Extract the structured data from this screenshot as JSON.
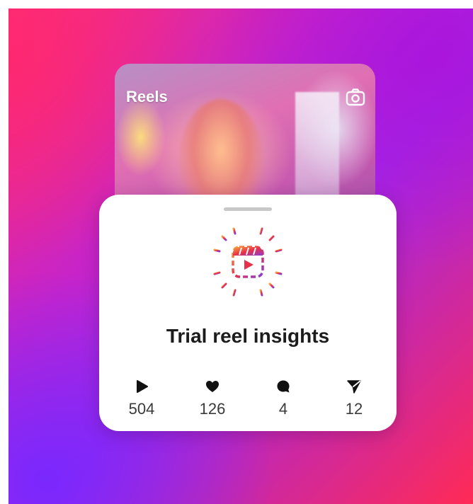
{
  "reel_preview": {
    "title": "Reels",
    "camera_icon": "camera-icon"
  },
  "insights": {
    "title": "Trial reel insights",
    "header_icon": "reel-burst-icon",
    "stats": [
      {
        "icon": "play-icon",
        "value": "504"
      },
      {
        "icon": "heart-icon",
        "value": "126"
      },
      {
        "icon": "comment-icon",
        "value": "4"
      },
      {
        "icon": "share-icon",
        "value": "12"
      }
    ]
  },
  "colors": {
    "gradient_pink": "#ff2d78",
    "gradient_purple": "#a127e6",
    "gradient_red": "#ff2a55",
    "icon_orange": "#f7a23a",
    "icon_red": "#e8304a",
    "icon_purple": "#8b3bd6",
    "stat_icon": "#111111",
    "stat_text": "#3a3a3a"
  }
}
